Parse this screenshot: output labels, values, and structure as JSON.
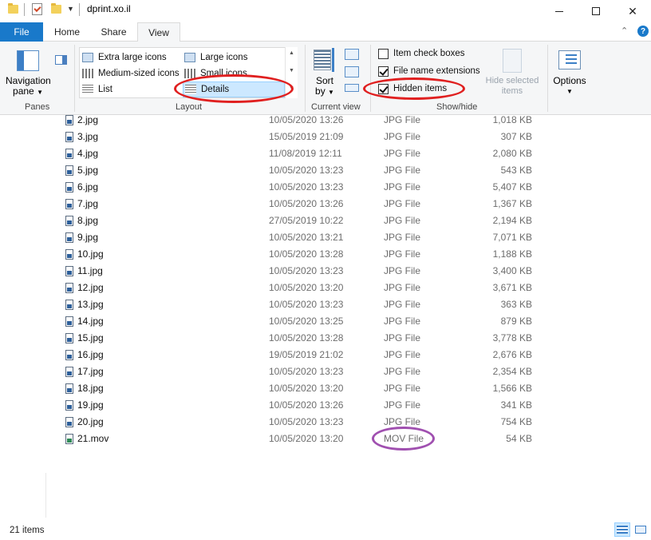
{
  "window": {
    "title": "dprint.xo.il"
  },
  "ribbon_tabs": {
    "file": "File",
    "home": "Home",
    "share": "Share",
    "view": "View"
  },
  "ribbon": {
    "panes": {
      "navigation_pane_line1": "Navigation",
      "navigation_pane_line2": "pane",
      "label": "Panes"
    },
    "layout": {
      "extra_large_icons": "Extra large icons",
      "large_icons": "Large icons",
      "medium_icons": "Medium-sized icons",
      "small_icons": "Small icons",
      "list": "List",
      "details": "Details",
      "label": "Layout"
    },
    "current_view": {
      "sort_line1": "Sort",
      "sort_line2": "by",
      "label": "Current view"
    },
    "show_hide": {
      "item_check_boxes": "Item check boxes",
      "item_check_boxes_checked": false,
      "file_name_extensions": "File name extensions",
      "file_name_extensions_checked": true,
      "hidden_items": "Hidden items",
      "hidden_items_checked": true,
      "hide_selected_line1": "Hide selected",
      "hide_selected_line2": "items",
      "label": "Show/hide"
    },
    "options": {
      "label": "Options"
    }
  },
  "files": [
    {
      "name": "2.jpg",
      "date": "10/05/2020 13:26",
      "type": "JPG File",
      "size": "1,018 KB"
    },
    {
      "name": "3.jpg",
      "date": "15/05/2019 21:09",
      "type": "JPG File",
      "size": "307 KB"
    },
    {
      "name": "4.jpg",
      "date": "11/08/2019 12:11",
      "type": "JPG File",
      "size": "2,080 KB"
    },
    {
      "name": "5.jpg",
      "date": "10/05/2020 13:23",
      "type": "JPG File",
      "size": "543 KB"
    },
    {
      "name": "6.jpg",
      "date": "10/05/2020 13:23",
      "type": "JPG File",
      "size": "5,407 KB"
    },
    {
      "name": "7.jpg",
      "date": "10/05/2020 13:26",
      "type": "JPG File",
      "size": "1,367 KB"
    },
    {
      "name": "8.jpg",
      "date": "27/05/2019 10:22",
      "type": "JPG File",
      "size": "2,194 KB"
    },
    {
      "name": "9.jpg",
      "date": "10/05/2020 13:21",
      "type": "JPG File",
      "size": "7,071 KB"
    },
    {
      "name": "10.jpg",
      "date": "10/05/2020 13:28",
      "type": "JPG File",
      "size": "1,188 KB"
    },
    {
      "name": "11.jpg",
      "date": "10/05/2020 13:23",
      "type": "JPG File",
      "size": "3,400 KB"
    },
    {
      "name": "12.jpg",
      "date": "10/05/2020 13:20",
      "type": "JPG File",
      "size": "3,671 KB"
    },
    {
      "name": "13.jpg",
      "date": "10/05/2020 13:23",
      "type": "JPG File",
      "size": "363 KB"
    },
    {
      "name": "14.jpg",
      "date": "10/05/2020 13:25",
      "type": "JPG File",
      "size": "879 KB"
    },
    {
      "name": "15.jpg",
      "date": "10/05/2020 13:28",
      "type": "JPG File",
      "size": "3,778 KB"
    },
    {
      "name": "16.jpg",
      "date": "19/05/2019 21:02",
      "type": "JPG File",
      "size": "2,676 KB"
    },
    {
      "name": "17.jpg",
      "date": "10/05/2020 13:23",
      "type": "JPG File",
      "size": "2,354 KB"
    },
    {
      "name": "18.jpg",
      "date": "10/05/2020 13:20",
      "type": "JPG File",
      "size": "1,566 KB"
    },
    {
      "name": "19.jpg",
      "date": "10/05/2020 13:26",
      "type": "JPG File",
      "size": "341 KB"
    },
    {
      "name": "20.jpg",
      "date": "10/05/2020 13:23",
      "type": "JPG File",
      "size": "754 KB"
    },
    {
      "name": "21.mov",
      "date": "10/05/2020 13:20",
      "type": "MOV File",
      "size": "54 KB",
      "icon": "video-file-icon"
    }
  ],
  "status": {
    "item_count": "21 items"
  },
  "colors": {
    "accent": "#1979ca",
    "annotation_red": "#e02020",
    "annotation_purple": "#a050b0"
  }
}
